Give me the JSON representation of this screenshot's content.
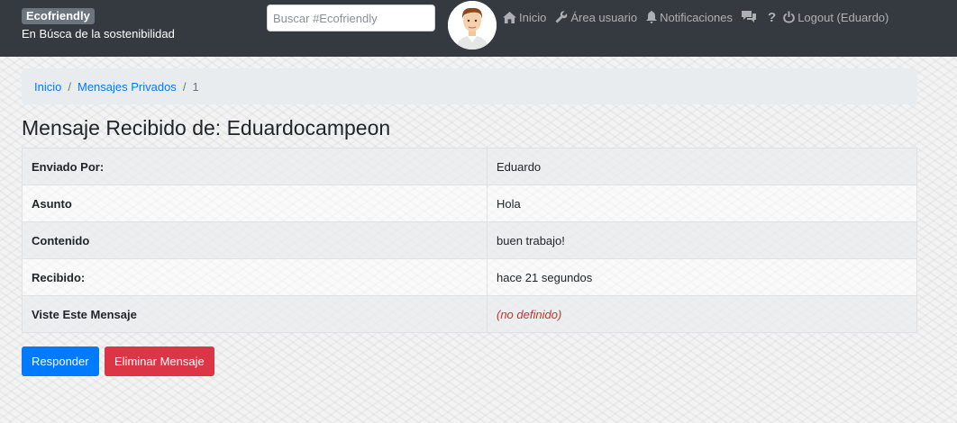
{
  "navbar": {
    "brand": "Ecofriendly",
    "tagline": "En Búsca de la sostenibilidad",
    "search_placeholder": "Buscar #Ecofriendly",
    "items": [
      {
        "label": "Inicio",
        "icon": "home-icon"
      },
      {
        "label": "Área usuario",
        "icon": "wrench-icon"
      },
      {
        "label": "Notificaciones",
        "icon": "bell-icon"
      },
      {
        "label": "",
        "icon": "messages-icon"
      },
      {
        "label": "?",
        "icon": "help-icon"
      },
      {
        "label": "Logout (Eduardo)",
        "icon": "power-icon"
      }
    ]
  },
  "breadcrumb": {
    "items": [
      "Inicio",
      "Mensajes Privados"
    ],
    "current": "1"
  },
  "page_title": "Mensaje Recibido de: Eduardocampeon",
  "details": [
    {
      "label": "Enviado Por:",
      "value": "Eduardo"
    },
    {
      "label": "Asunto",
      "value": "Hola"
    },
    {
      "label": "Contenido",
      "value": "buen trabajo!"
    },
    {
      "label": "Recibido:",
      "value": "hace 21 segundos"
    },
    {
      "label": "Viste Este Mensaje",
      "value": "(no definido)"
    }
  ],
  "actions": {
    "reply": "Responder",
    "delete": "Eliminar Mensaje"
  },
  "colors": {
    "navbar": "#343a40",
    "primary": "#007bff",
    "danger": "#dc3545"
  }
}
